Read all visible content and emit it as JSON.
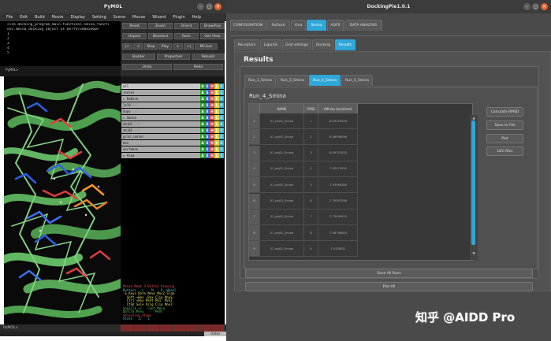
{
  "pymol": {
    "window_title": "PyMOL",
    "menu": [
      "File",
      "Edit",
      "Build",
      "Movie",
      "Display",
      "Setting",
      "Scene",
      "Mouse",
      "Wizard",
      "Plugin",
      "Help"
    ],
    "console_lines": [
      "<lib.docking_program_main.functions.smina_functi",
      "ons.Smina_docking object at 0x7fe73e0a5e60>",
      "1",
      "2",
      "3",
      "4",
      "5"
    ],
    "prompt": "PyMOL>",
    "buttons": [
      "Reset",
      "Zoom",
      "Orient",
      "Draw/Ray",
      "Unpick",
      "Deselect",
      "Rock",
      "Get View",
      "|<",
      "<",
      "Stop",
      "Play",
      ">",
      ">|",
      "MClear",
      "Builder",
      "Properties",
      "Rebuild",
      "Undo",
      "Redo"
    ],
    "objects": [
      {
        "name": "all",
        "state": ""
      },
      {
        "name": "(sele)",
        "state": ""
      },
      {
        "name": "RxDock",
        "state": ""
      },
      {
        "name": "1sl8",
        "state": "1/1"
      },
      {
        "name": "6upo",
        "state": "1/1"
      },
      {
        "name": "Smina",
        "state": ""
      },
      {
        "name": "obj01",
        "state": "9/9"
      },
      {
        "name": "obj02",
        "state": "9/9"
      },
      {
        "name": "grid_center",
        "state": ""
      },
      {
        "name": "box",
        "state": ""
      },
      {
        "name": "vertebox",
        "state": ""
      },
      {
        "name": "Vina",
        "state": ""
      }
    ],
    "ahsl": [
      "A",
      "S",
      "H",
      "L",
      "C"
    ],
    "mouse_lines": [
      {
        "text": "Mouse Mode 3-Button Viewing",
        "cls": "r"
      },
      {
        "text": "Buttons   L    M    R  Wheel",
        "cls": "c"
      },
      {
        "text": " & Keys Rota Move MovZ Slab",
        "cls": "y"
      },
      {
        "text": "  Shft +Box -Box Clip MovS",
        "cls": "y"
      },
      {
        "text": "  Ctrl +Box PkAt Pk1  MvSZ",
        "cls": "y"
      },
      {
        "text": "  CtSh Sele Orig Clip MovZ",
        "cls": "y"
      },
      {
        "text": "SnglClk +/-  Cent Menu",
        "cls": "g"
      },
      {
        "text": "DblClk Menu   -  PkAt",
        "cls": "g"
      },
      {
        "text": "Selecting Atoms",
        "cls": "r"
      },
      {
        "text": "State   1/   1",
        "cls": "c"
      }
    ],
    "status": "PyMOL>",
    "states_label": "states"
  },
  "dockingpie": {
    "window_title": "DockingPie1.0.1",
    "main_tabs": [
      "CONFIGURATION",
      "RxDock",
      "Vina",
      "Smina",
      "ADFR",
      "DATA ANALYSIS"
    ],
    "main_tab_selected": 3,
    "sub_tabs": [
      "Receptors",
      "Ligands",
      "Grid settings",
      "Docking",
      "Results"
    ],
    "sub_tab_selected": 4,
    "results_title": "Results",
    "run_tabs": [
      "Run_1_Smina",
      "Run_3_Smina",
      "Run_4_Smina",
      "Run_5_Smina"
    ],
    "run_tab_selected": 2,
    "run_title": "Run_4_Smina",
    "columns": [
      "NAME",
      "POSE",
      "Affinity (kcal/mol)"
    ],
    "rows": [
      {
        "n": "1",
        "name": "01_obj01_Smina",
        "pose": "1",
        "aff": "-8.09225026"
      },
      {
        "n": "2",
        "name": "01_obj01_Smina",
        "pose": "2",
        "aff": "-8.36998096"
      },
      {
        "n": "3",
        "name": "01_obj01_Smina",
        "pose": "3",
        "aff": "-8.09707833"
      },
      {
        "n": "4",
        "name": "01_obj01_Smina",
        "pose": "4",
        "aff": "-7.93079592"
      },
      {
        "n": "5",
        "name": "01_obj01_Smina",
        "pose": "5",
        "aff": "-7.93968389"
      },
      {
        "n": "6",
        "name": "01_obj01_Smina",
        "pose": "6",
        "aff": "-7.79597596"
      },
      {
        "n": "7",
        "name": "01_obj01_Smina",
        "pose": "7",
        "aff": "-7.73449915"
      },
      {
        "n": "8",
        "name": "01_obj01_Smina",
        "pose": "8",
        "aff": "-7.58796083"
      },
      {
        "n": "9",
        "name": "01_obj01_Smina",
        "pose": "9",
        "aff": "-7.4138051"
      }
    ],
    "right_buttons": [
      "Calculate RMSD",
      "Save to File",
      "Plot",
      "LOG files"
    ],
    "save_all_runs": "Save All Runs",
    "plot_all": "Plot All"
  },
  "watermark": "知乎 @AIDD Pro"
}
